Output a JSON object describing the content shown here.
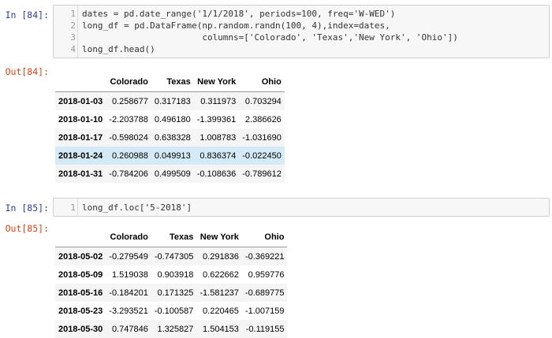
{
  "cell84": {
    "in_prompt": "In [84]:",
    "out_prompt": "Out[84]:",
    "lines": [
      {
        "n": "1",
        "code": "dates = pd.date_range('1/1/2018', periods=100, freq='W-WED')"
      },
      {
        "n": "2",
        "code": "long_df = pd.DataFrame(np.random.randn(100, 4),index=dates,"
      },
      {
        "n": "3",
        "code": "                       columns=['Colorado', 'Texas','New York', 'Ohio'])"
      },
      {
        "n": "4",
        "code": "long_df.head()"
      }
    ],
    "columns": [
      "Colorado",
      "Texas",
      "New York",
      "Ohio"
    ],
    "rows": [
      {
        "index": "2018-01-03",
        "cells": [
          "0.258677",
          "0.317183",
          "0.311973",
          "0.703294"
        ]
      },
      {
        "index": "2018-01-10",
        "cells": [
          "-2.203788",
          "0.496180",
          "-1.399361",
          "2.386626"
        ]
      },
      {
        "index": "2018-01-17",
        "cells": [
          "-0.598024",
          "0.638328",
          "1.008783",
          "-1.031690"
        ]
      },
      {
        "index": "2018-01-24",
        "cells": [
          "0.260988",
          "0.049913",
          "0.836374",
          "-0.022450"
        ]
      },
      {
        "index": "2018-01-31",
        "cells": [
          "-0.784206",
          "0.499509",
          "-0.108636",
          "-0.789612"
        ]
      }
    ]
  },
  "cell85": {
    "in_prompt": "In [85]:",
    "out_prompt": "Out[85]:",
    "lines": [
      {
        "n": "1",
        "code": "long_df.loc['5-2018']"
      }
    ],
    "columns": [
      "Colorado",
      "Texas",
      "New York",
      "Ohio"
    ],
    "rows": [
      {
        "index": "2018-05-02",
        "cells": [
          "-0.279549",
          "-0.747305",
          "0.291836",
          "-0.369221"
        ]
      },
      {
        "index": "2018-05-09",
        "cells": [
          "1.519038",
          "0.903918",
          "0.622662",
          "0.959776"
        ]
      },
      {
        "index": "2018-05-16",
        "cells": [
          "-0.184201",
          "0.171325",
          "-1.581237",
          "-0.689775"
        ]
      },
      {
        "index": "2018-05-23",
        "cells": [
          "-3.293521",
          "-0.100587",
          "0.220465",
          "-1.007159"
        ]
      },
      {
        "index": "2018-05-30",
        "cells": [
          "0.747846",
          "1.325827",
          "1.504153",
          "-0.119155"
        ]
      }
    ]
  }
}
